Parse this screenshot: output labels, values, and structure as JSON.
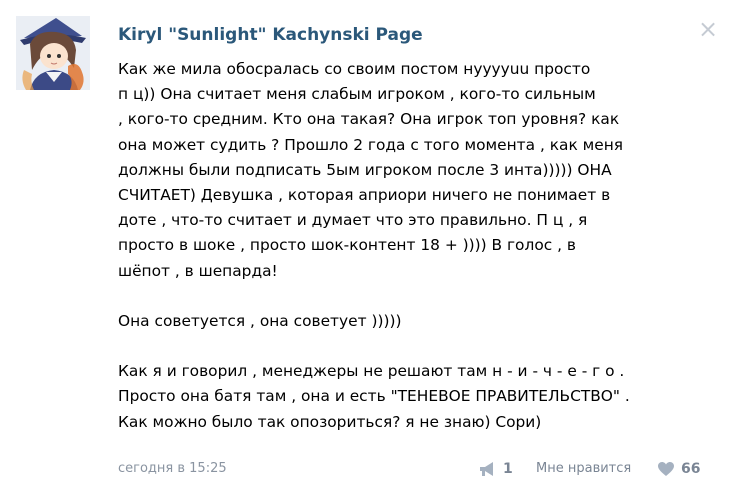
{
  "post": {
    "author": "Kiryl \"Sunlight\" Kachynski Page",
    "close_icon": "close-icon",
    "lines": [
      "Как же мила обосралась со своим постом нууууuu просто",
      "п        ц)) Она считает меня слабым игроком , кого-то сильным",
      " , кого-то средним. Кто она такая? Она игрок топ уровня? как",
      "она может судить ? Прошло 2 года с того момента , как меня",
      "должны были подписать 5ым игроком после 3 инта))))) ОНА",
      "СЧИТАЕТ) Девушка , которая априори ничего не понимает в",
      "доте , что-то считает и думает что это правильно. П        ц , я",
      "просто в шоке , просто шок-контент  18 + )))) В голос , в",
      "шёпот , в шепарда!",
      "",
      "Она советуется , она советует )))))",
      "",
      "Как я и говорил , менеджеры не решают там н - и - ч - е - г о .",
      "Просто она батя там , она и есть \"ТЕНЕВОЕ ПРАВИТЕЛЬСТВО\" .",
      "Как можно было так опозориться? я не знаю) Сори)"
    ],
    "timestamp": "сегодня в 15:25",
    "share_count": "1",
    "like_label": "Мне нравится",
    "like_count": "66",
    "colors": {
      "author": "#2b587a",
      "meta": "#8a94a1",
      "icon": "#a5b1c0"
    }
  }
}
